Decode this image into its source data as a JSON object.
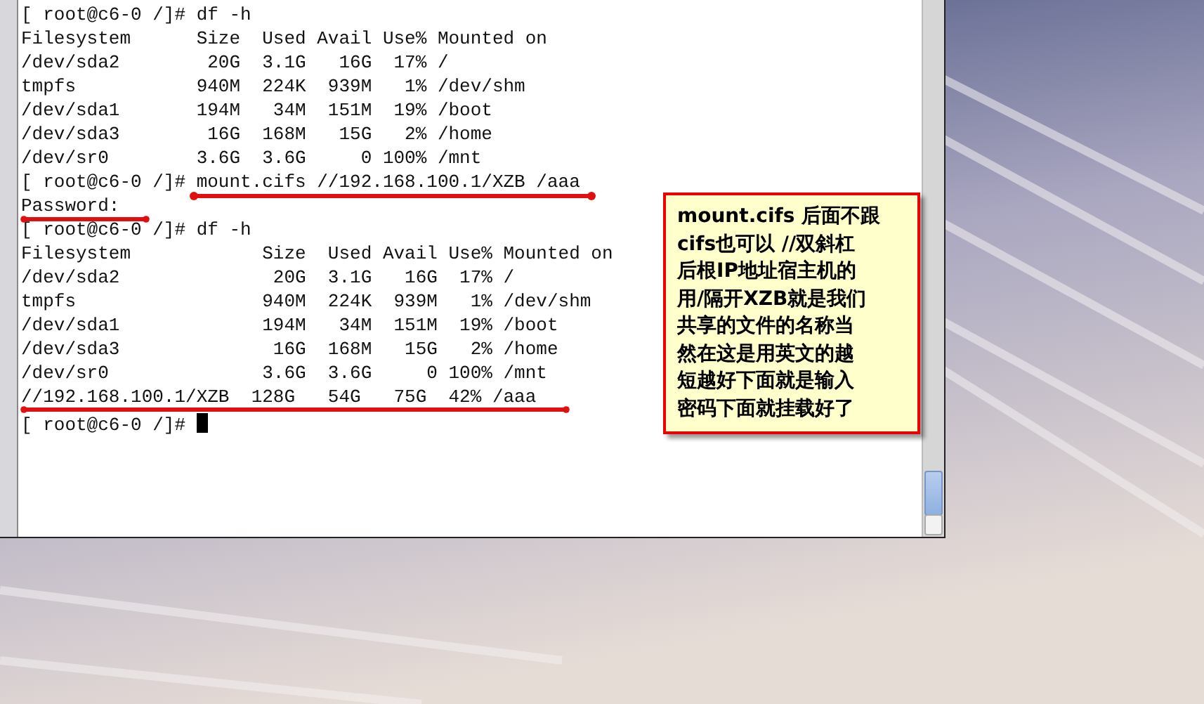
{
  "terminal": {
    "lines": [
      "[ root@c6-0 /]# df -h",
      "Filesystem      Size  Used Avail Use% Mounted on",
      "/dev/sda2        20G  3.1G   16G  17% /",
      "tmpfs           940M  224K  939M   1% /dev/shm",
      "/dev/sda1       194M   34M  151M  19% /boot",
      "/dev/sda3        16G  168M   15G   2% /home",
      "/dev/sr0        3.6G  3.6G     0 100% /mnt",
      "[ root@c6-0 /]# mount.cifs //192.168.100.1/XZB /aaa",
      "Password:",
      "[ root@c6-0 /]# df -h",
      "Filesystem            Size  Used Avail Use% Mounted on",
      "/dev/sda2              20G  3.1G   16G  17% /",
      "tmpfs                 940M  224K  939M   1% /dev/shm",
      "/dev/sda1             194M   34M  151M  19% /boot",
      "/dev/sda3              16G  168M   15G   2% /home",
      "/dev/sr0              3.6G  3.6G     0 100% /mnt",
      "//192.168.100.1/XZB  128G   54G   75G  42% /aaa"
    ],
    "prompt": "[ root@c6-0 /]# "
  },
  "annotation": {
    "lines": [
      "mount.cifs 后面不跟",
      "cifs也可以 //双斜杠",
      "后根IP地址宿主机的",
      "用/隔开XZB就是我们",
      "共享的文件的名称当",
      "然在这是用英文的越",
      "短越好下面就是输入",
      "密码下面就挂载好了"
    ]
  }
}
